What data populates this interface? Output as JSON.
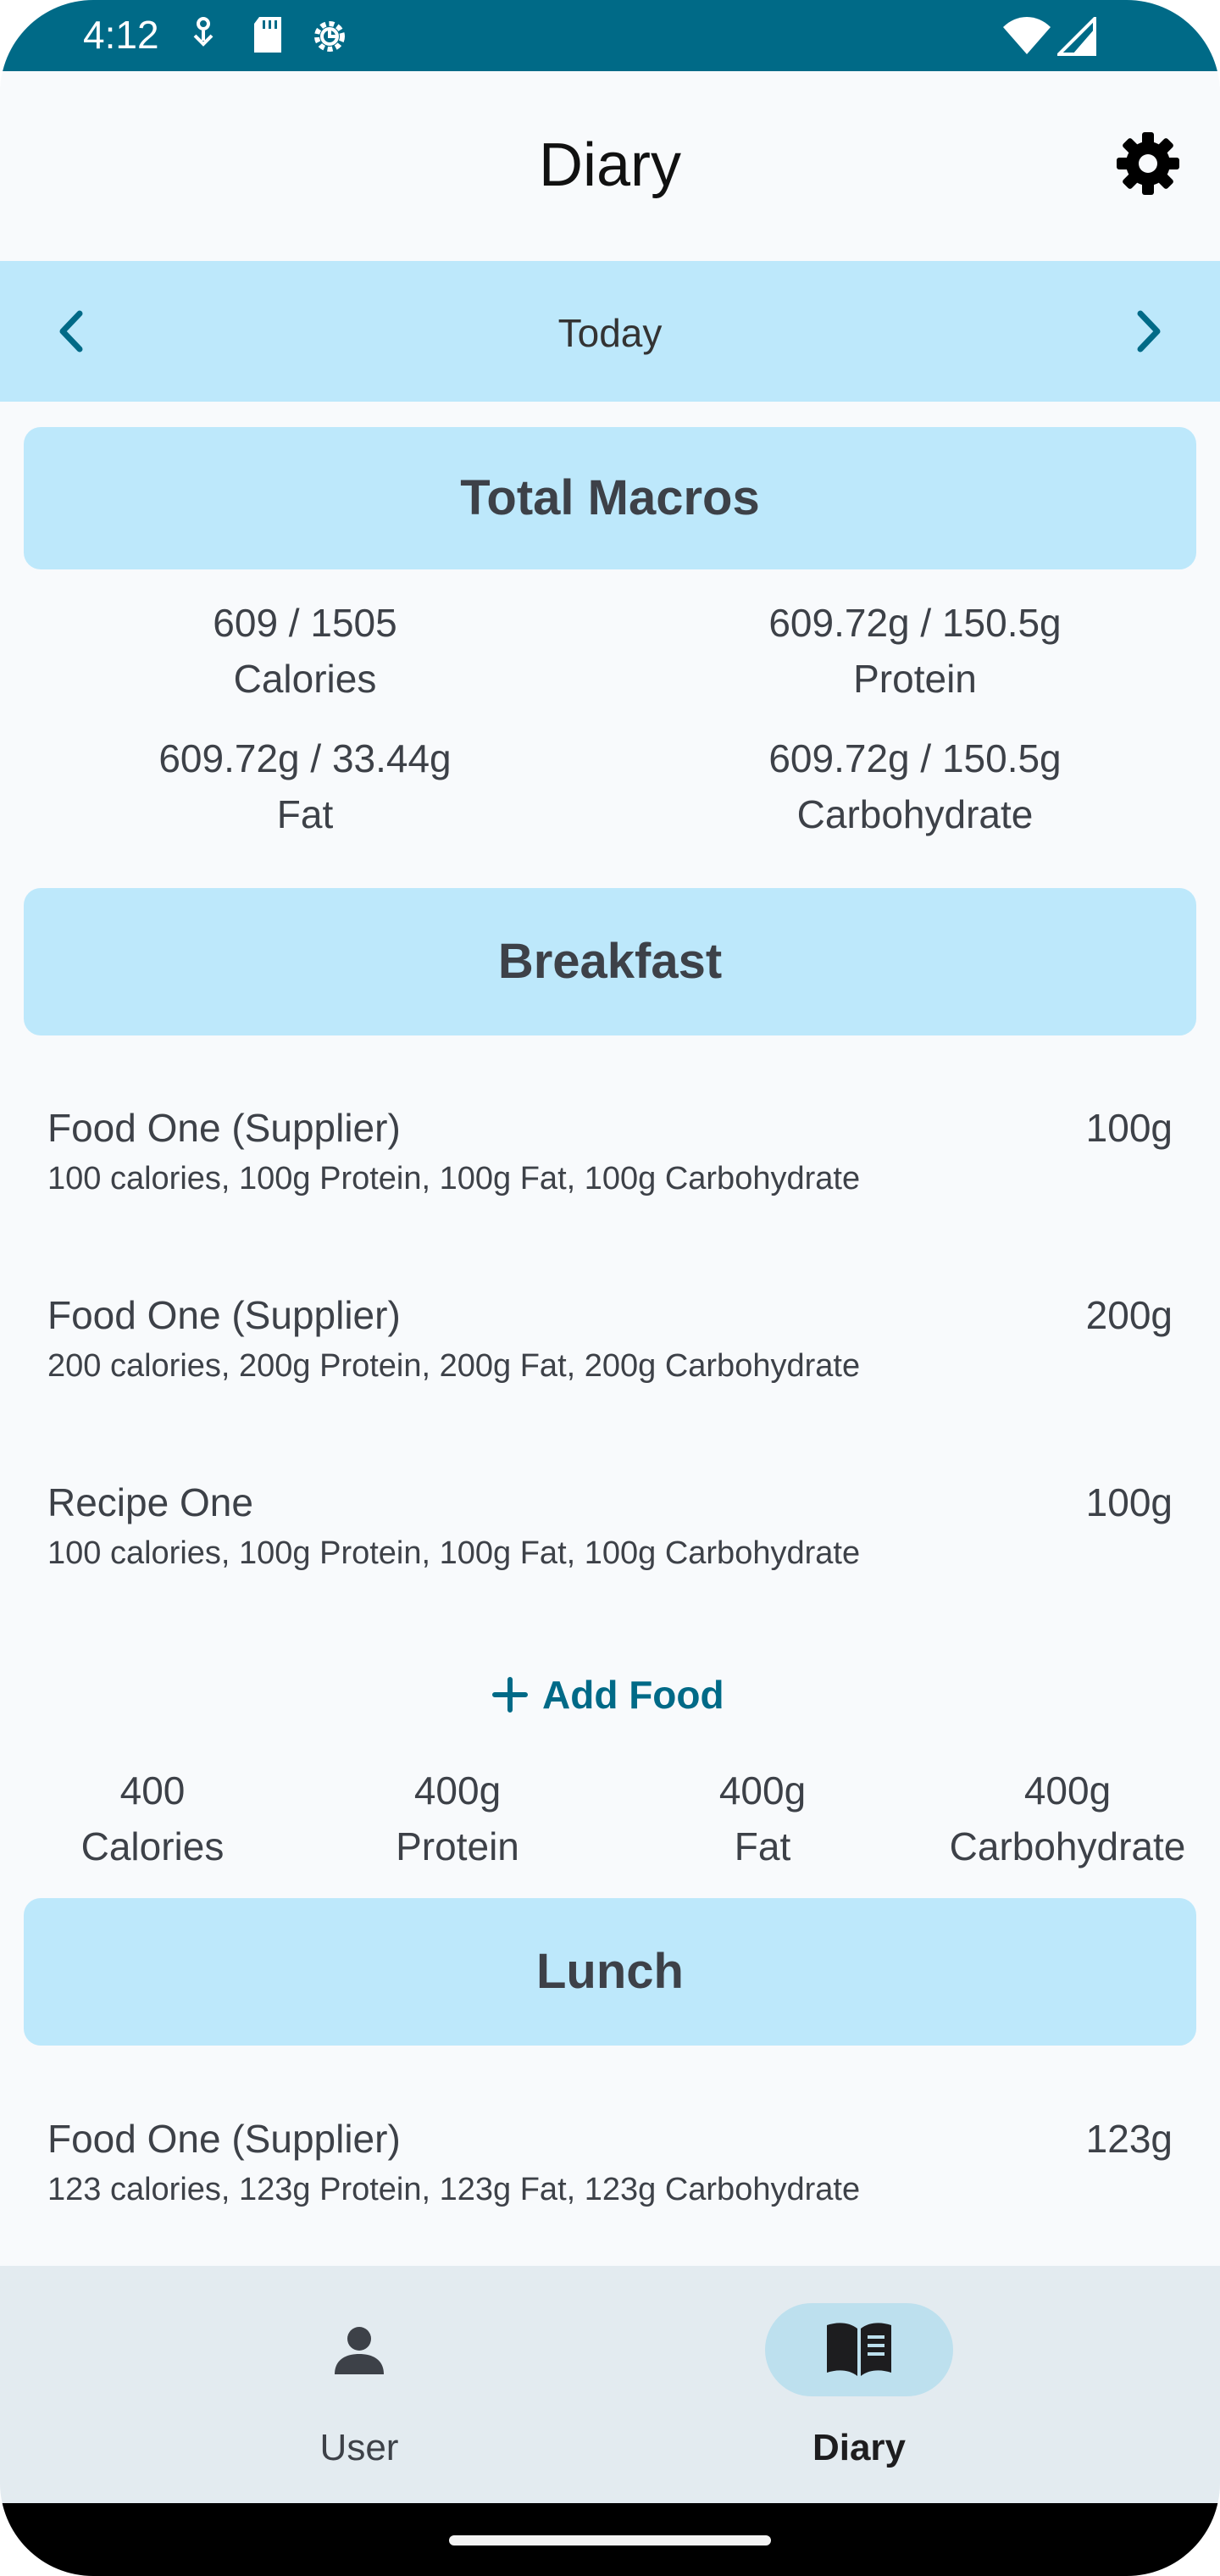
{
  "status_bar": {
    "time": "4:12"
  },
  "app_bar": {
    "title": "Diary"
  },
  "date_nav": {
    "label": "Today"
  },
  "total_macros": {
    "title": "Total Macros",
    "stats": [
      {
        "value": "609 / 1505",
        "label": "Calories"
      },
      {
        "value": "609.72g / 150.5g",
        "label": "Protein"
      },
      {
        "value": "609.72g / 33.44g",
        "label": "Fat"
      },
      {
        "value": "609.72g / 150.5g",
        "label": "Carbohydrate"
      }
    ]
  },
  "breakfast": {
    "title": "Breakfast",
    "items": [
      {
        "name": "Food One (Supplier)",
        "amount": "100g",
        "detail": "100 calories, 100g Protein, 100g Fat, 100g Carbohydrate"
      },
      {
        "name": "Food One (Supplier)",
        "amount": "200g",
        "detail": "200 calories, 200g Protein, 200g Fat, 200g Carbohydrate"
      },
      {
        "name": "Recipe One",
        "amount": "100g",
        "detail": "100 calories, 100g Protein, 100g Fat, 100g Carbohydrate"
      }
    ],
    "add_label": "Add Food",
    "totals": [
      {
        "value": "400",
        "label": "Calories"
      },
      {
        "value": "400g",
        "label": "Protein"
      },
      {
        "value": "400g",
        "label": "Fat"
      },
      {
        "value": "400g",
        "label": "Carbohydrate"
      }
    ]
  },
  "lunch": {
    "title": "Lunch",
    "items": [
      {
        "name": "Food One (Supplier)",
        "amount": "123g",
        "detail": "123 calories, 123g Protein, 123g Fat, 123g Carbohydrate"
      }
    ]
  },
  "bottom_nav": {
    "items": [
      {
        "label": "User",
        "icon": "person-icon",
        "active": false
      },
      {
        "label": "Diary",
        "icon": "book-icon",
        "active": true
      }
    ]
  },
  "colors": {
    "status_bar": "#006a87",
    "accent": "#006a87",
    "section_header": "#bde8fb",
    "bottom_nav": "#e3ebf0"
  }
}
